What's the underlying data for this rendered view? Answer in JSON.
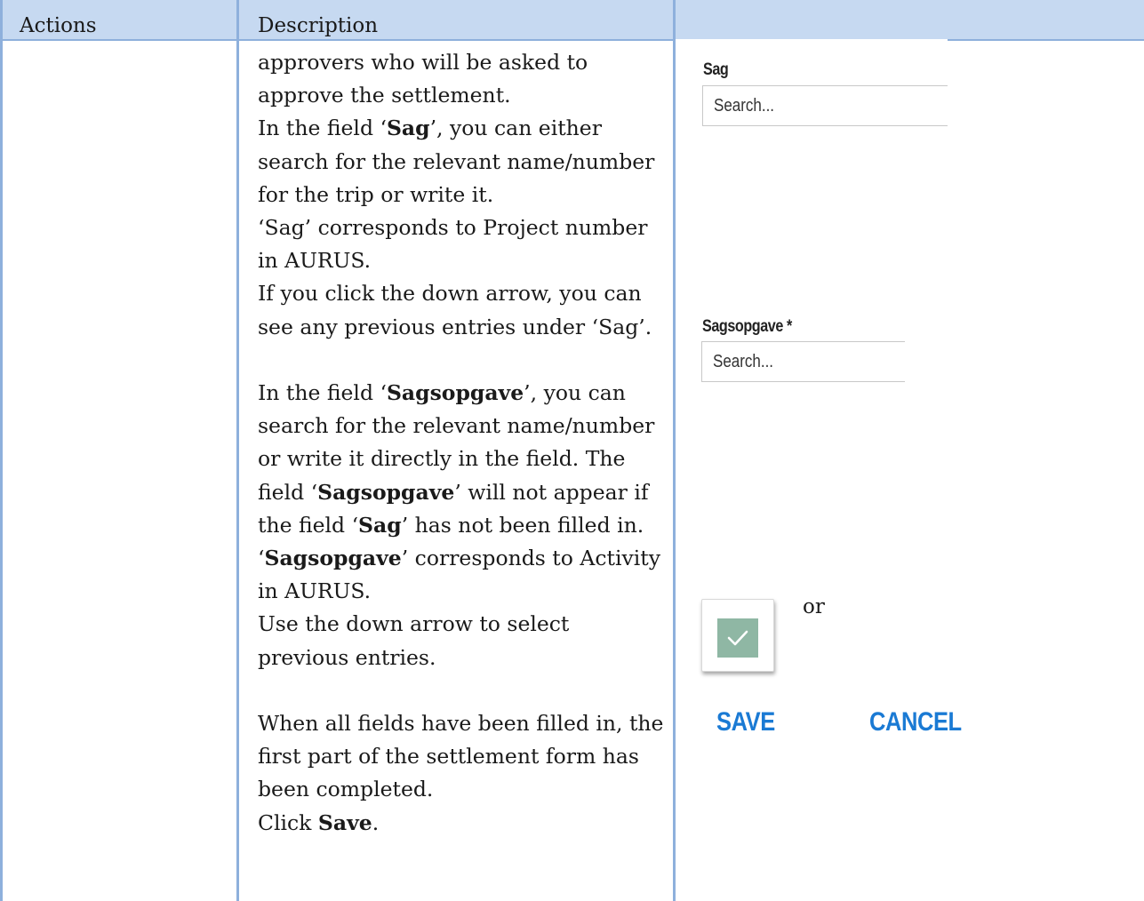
{
  "table": {
    "headers": [
      "Actions",
      "Description",
      ""
    ]
  },
  "description": {
    "p1": "approvers who will be asked to approve the settlement.",
    "p2_pre": "In the field ‘",
    "p2_bold": "Sag",
    "p2_post": "’, you can either search for the relevant name/number for the trip or write it.",
    "p3": "‘Sag’ corresponds to Project number in AURUS.",
    "p4": "If you click the down arrow, you can see any previous entries under ‘Sag’.",
    "p5_pre": "In the field ‘",
    "p5_bold": "Sagsopgave",
    "p5_post": "’, you can search for the relevant name/number or write it directly in the field. The field ‘",
    "p5_bold2": "Sagsopgave",
    "p5_mid": "’ will not appear if the field ‘",
    "p5_bold3": "Sag",
    "p5_end": "’ has not been filled in.",
    "p6_pre": "‘",
    "p6_bold": "Sagsopgave",
    "p6_post": "’ corresponds to Activity in AURUS.",
    "p7": "Use the down arrow to select previous entries.",
    "p8": "When all fields have been filled in, the first part of the settlement form has been completed.",
    "p9_pre": "Click ",
    "p9_bold": "Save",
    "p9_post": "."
  },
  "ui": {
    "sag_label": "Sag",
    "sag_placeholder": "Search...",
    "sagsopgave_label": "Sagsopgave *",
    "sagsopgave_placeholder": "Search...",
    "or_text": "or",
    "save_label": "SAVE",
    "cancel_label": "CANCEL",
    "check_icon": "check-icon"
  },
  "colors": {
    "header_bg": "#c6d9f1",
    "rule": "#8eb0dc",
    "accent_blue": "#1a7ad4",
    "check_green": "#8fb7a4"
  }
}
